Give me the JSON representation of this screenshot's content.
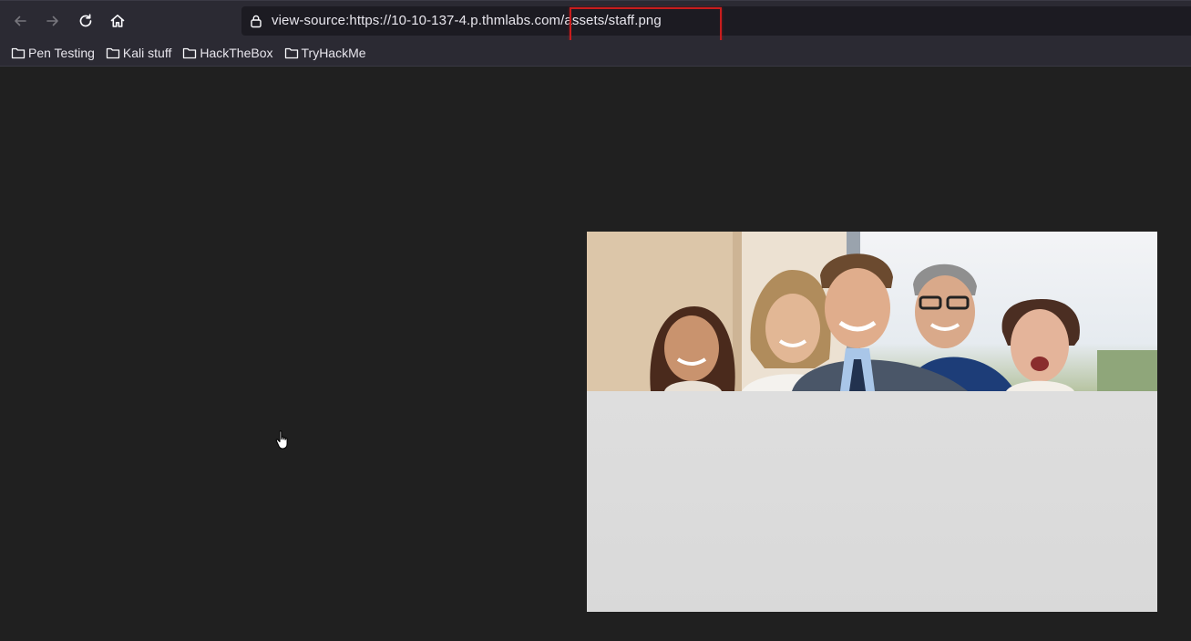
{
  "toolbar": {
    "back_icon": "arrow-left-icon",
    "forward_icon": "arrow-right-icon",
    "reload_icon": "reload-icon",
    "home_icon": "home-icon"
  },
  "urlbar": {
    "url": "view-source:https://10-10-137-4.p.thmlabs.com/assets/staff.png",
    "lock_icon": "lock-icon",
    "highlight_color": "#c81d1d"
  },
  "bookmarks": {
    "items": [
      {
        "label": "Pen Testing",
        "icon": "folder-icon"
      },
      {
        "label": "Kali stuff",
        "icon": "folder-icon"
      },
      {
        "label": "HackTheBox",
        "icon": "folder-icon"
      },
      {
        "label": "TryHackMe",
        "icon": "folder-icon"
      }
    ]
  },
  "content": {
    "image_name": "staff.png",
    "background": "#202020"
  },
  "colors": {
    "chrome": "#2b2a33",
    "urlbar_bg": "#1c1b22",
    "text": "#e8e6ed"
  }
}
